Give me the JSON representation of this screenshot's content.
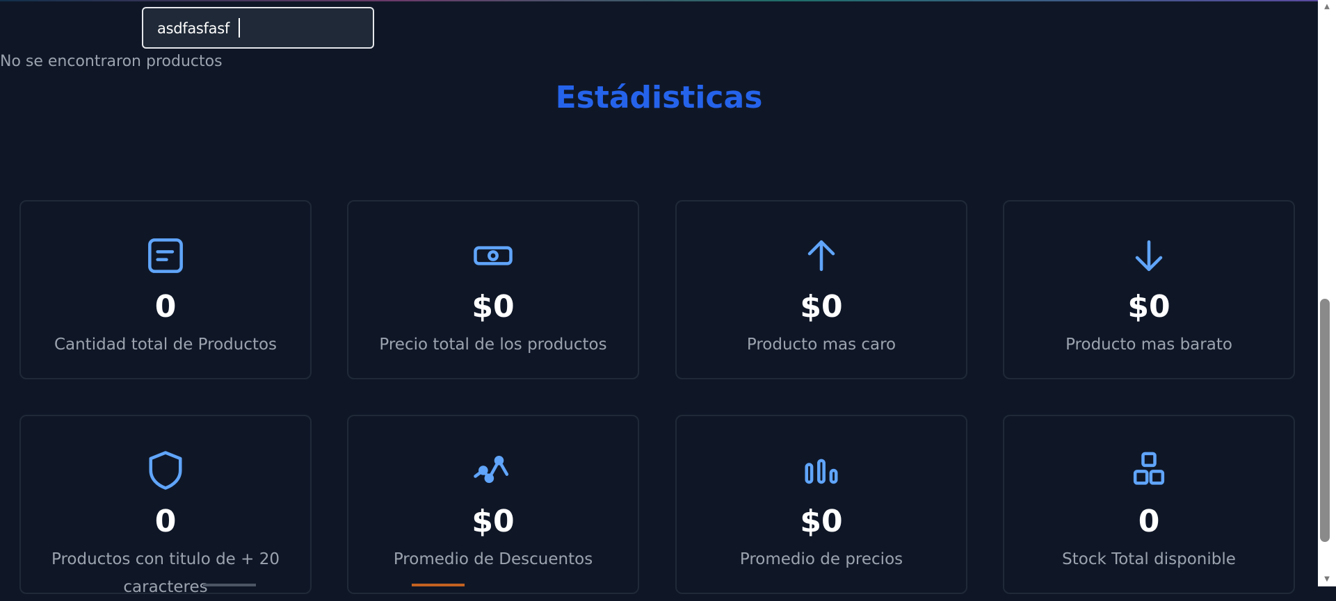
{
  "search": {
    "value": "asdfasfasf"
  },
  "products": {
    "empty_message": "No se encontraron productos"
  },
  "stats": {
    "title": "Estádisticas",
    "cards": [
      {
        "icon": "document-icon",
        "value": "0",
        "label": "Cantidad total de Productos"
      },
      {
        "icon": "cash-icon",
        "value": "$0",
        "label": "Precio total de los productos"
      },
      {
        "icon": "arrow-up-icon",
        "value": "$0",
        "label": "Producto mas caro"
      },
      {
        "icon": "arrow-down-icon",
        "value": "$0",
        "label": "Producto mas barato"
      },
      {
        "icon": "shield-icon",
        "value": "0",
        "label": "Productos con titulo de + 20 caracteres"
      },
      {
        "icon": "trend-icon",
        "value": "$0",
        "label": "Promedio de Descuentos"
      },
      {
        "icon": "bar-chart-icon",
        "value": "$0",
        "label": "Promedio de precios"
      },
      {
        "icon": "boxes-icon",
        "value": "0",
        "label": "Stock Total disponible"
      }
    ]
  },
  "colors": {
    "background": "#0f1727",
    "accent": "#2563eb",
    "icon": "#60a5fa",
    "card_border": "#1f2937",
    "text_muted": "#9ca3af"
  }
}
